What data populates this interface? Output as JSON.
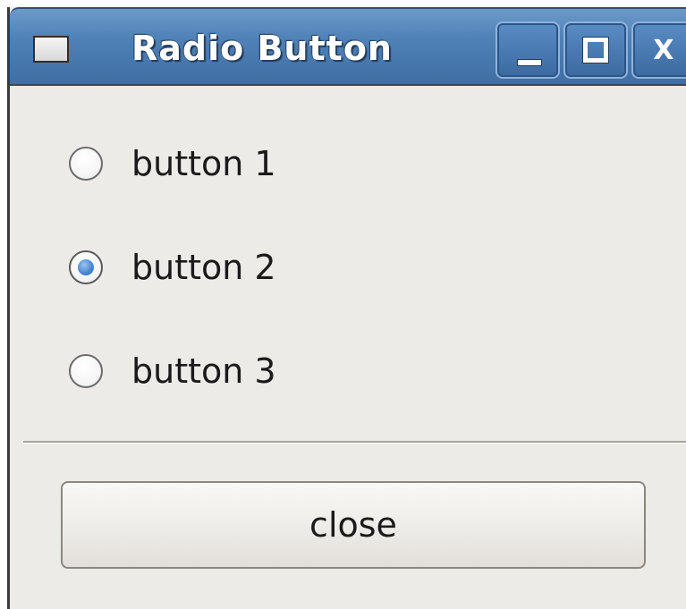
{
  "window": {
    "title": "Radio Button",
    "controls": {
      "minimize_icon": "minimize-icon",
      "maximize_icon": "maximize-icon",
      "close_icon": "close-icon",
      "close_glyph": "X"
    },
    "titlebar_color": "#4f81b7"
  },
  "radios": [
    {
      "label": "button 1",
      "checked": false
    },
    {
      "label": "button 2",
      "checked": true
    },
    {
      "label": "button 3",
      "checked": false
    }
  ],
  "actions": {
    "close_label": "close"
  },
  "colors": {
    "background": "#edebe7",
    "radio_accent": "#4a8ad4"
  }
}
